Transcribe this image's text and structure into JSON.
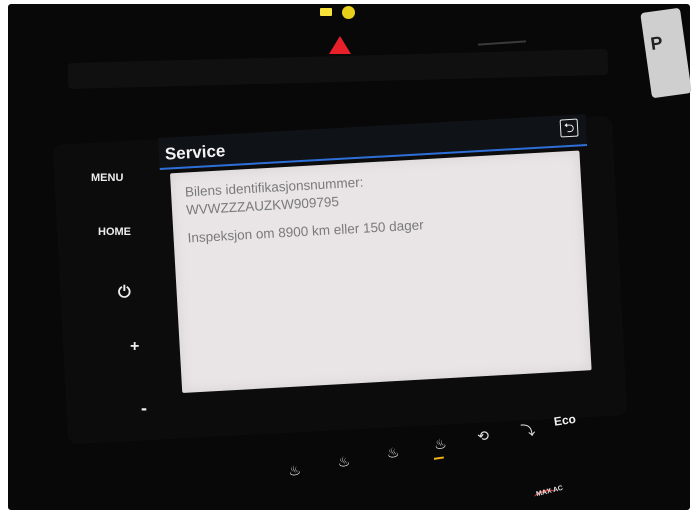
{
  "head_unit": {
    "buttons": {
      "menu": "MENU",
      "home": "HOME",
      "power_icon": "power-icon",
      "plus": "+",
      "minus": "-"
    }
  },
  "screen": {
    "title": "Service",
    "back_icon": "back-arrow-icon",
    "lines": [
      "Bilens identifikasjonsnummer:",
      "WVWZZZAUZKW909795",
      "Inspeksjon om 8900 km eller 150 dager"
    ],
    "accent_color": "#2f6fd8",
    "body_color": "#e9e5e6"
  },
  "climate_panel": {
    "eco_label": "Eco",
    "icons": [
      "seat-heat-icon",
      "seat-heat-icon",
      "seat-heat-icon",
      "seat-heat-icon",
      "recirculation-icon",
      "seat-icon"
    ],
    "max_ac_label": "MAX AC"
  },
  "dashboard": {
    "hazard_color": "#e8202a",
    "indicator_color": "#f7e23a",
    "badge_letter": "P"
  }
}
